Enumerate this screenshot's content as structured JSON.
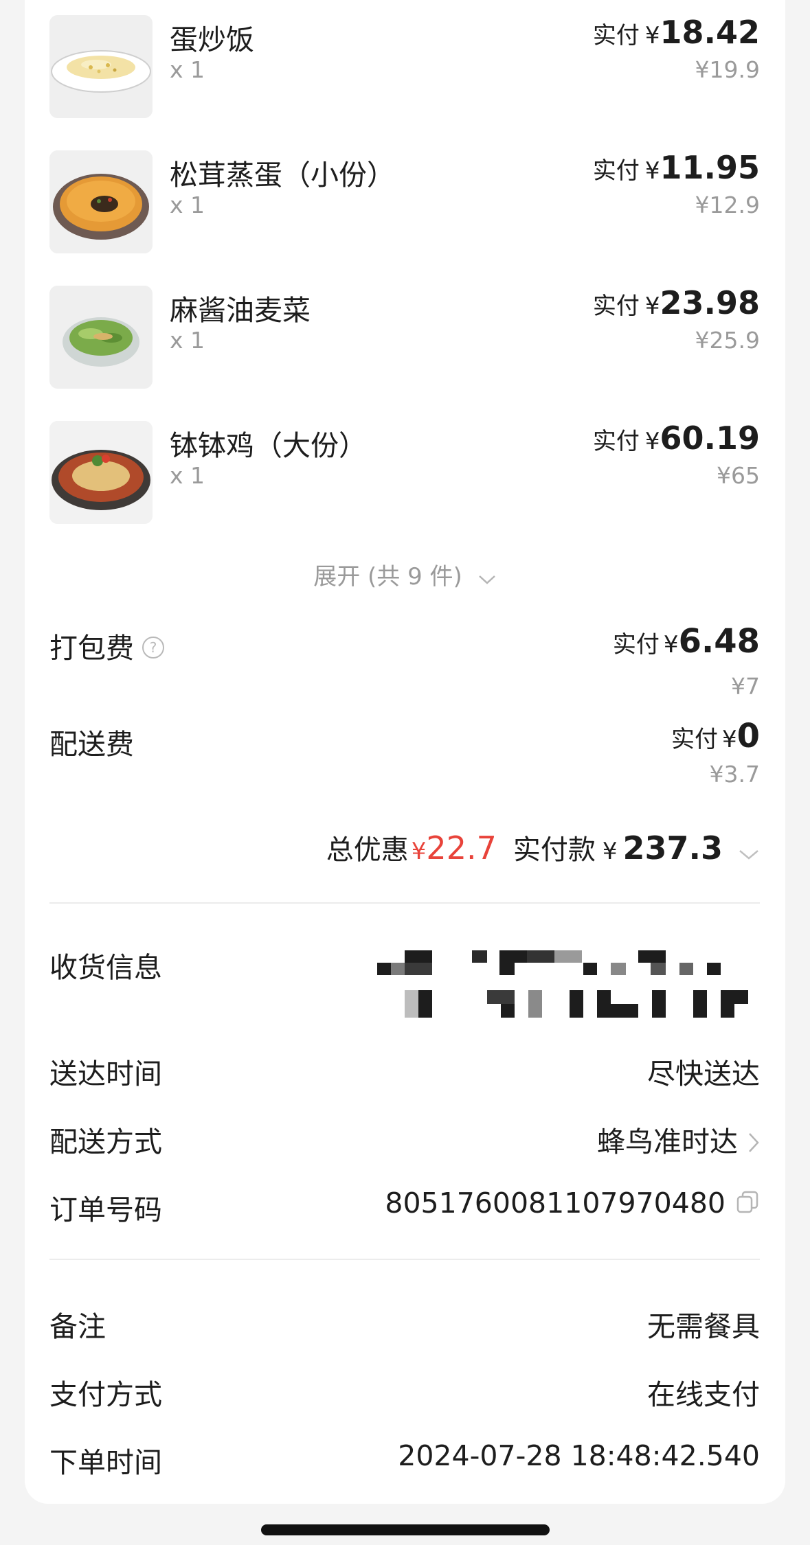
{
  "items": [
    {
      "name": "蛋炒饭",
      "qty": "x 1",
      "pay_label": "实付",
      "currency": "¥",
      "pay": "18.42",
      "original": "¥19.9",
      "image": "fried-rice-image"
    },
    {
      "name": "松茸蒸蛋（小份）",
      "qty": "x 1",
      "pay_label": "实付",
      "currency": "¥",
      "pay": "11.95",
      "original": "¥12.9",
      "image": "steamed-egg-image"
    },
    {
      "name": "麻酱油麦菜",
      "qty": "x 1",
      "pay_label": "实付",
      "currency": "¥",
      "pay": "23.98",
      "original": "¥25.9",
      "image": "lettuce-image"
    },
    {
      "name": "钵钵鸡（大份）",
      "qty": "x 1",
      "pay_label": "实付",
      "currency": "¥",
      "pay": "60.19",
      "original": "¥65",
      "image": "chicken-image"
    }
  ],
  "expand": {
    "label": "展开 (共 9 件)"
  },
  "fees": {
    "packing": {
      "label": "打包费",
      "pay_label": "实付",
      "currency": "¥",
      "pay": "6.48",
      "original": "¥7"
    },
    "delivery": {
      "label": "配送费",
      "pay_label": "实付",
      "currency": "¥",
      "pay": "0",
      "original": "¥3.7"
    }
  },
  "totals": {
    "discount_label": "总优惠",
    "discount_currency": "¥",
    "discount": "22.7",
    "paid_label": "实付款",
    "paid_currency": "¥",
    "paid": "237.3"
  },
  "info": {
    "receiver_label": "收货信息",
    "delivery_time_label": "送达时间",
    "delivery_time": "尽快送达",
    "delivery_method_label": "配送方式",
    "delivery_method": "蜂鸟准时达",
    "order_no_label": "订单号码",
    "order_no": "8051760081107970480",
    "remark_label": "备注",
    "remark": "无需餐具",
    "payment_label": "支付方式",
    "payment": "在线支付",
    "order_time_label": "下单时间",
    "order_time": "2024-07-28 18:48:42.540"
  },
  "colors": {
    "accent_red": "#e8433a",
    "muted": "#9a9a9a",
    "text": "#1d1d1d"
  }
}
